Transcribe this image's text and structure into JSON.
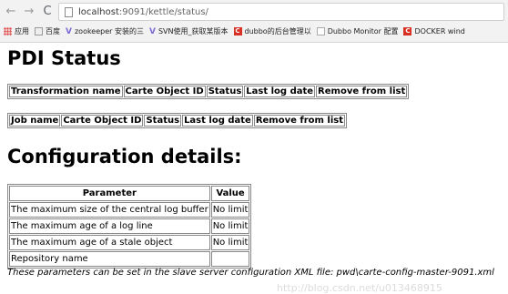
{
  "browser": {
    "back": "←",
    "forward": "→",
    "reload": "C",
    "url_host": "localhost",
    "url_rest": ":9091/kettle/status/",
    "bookmarks": [
      {
        "label": "应用",
        "icon": "apps-icon"
      },
      {
        "label": "百度",
        "icon": "folder-icon"
      },
      {
        "label": "zookeeper 安装的三",
        "icon": "v-icon"
      },
      {
        "label": "SVN使用_获取某版本",
        "icon": "v-icon"
      },
      {
        "label": "dubbo的后台管理以",
        "icon": "c-icon"
      },
      {
        "label": "Dubbo Monitor 配置",
        "icon": "page-icon"
      },
      {
        "label": "DOCKER wind",
        "icon": "c-icon"
      }
    ]
  },
  "page": {
    "title": "PDI Status",
    "transformations": {
      "headers": [
        "Transformation name",
        "Carte Object ID",
        "Status",
        "Last log date",
        "Remove from list"
      ]
    },
    "jobs": {
      "headers": [
        "Job name",
        "Carte Object ID",
        "Status",
        "Last log date",
        "Remove from list"
      ]
    },
    "config_title": "Configuration details:",
    "config": {
      "headers": [
        "Parameter",
        "Value"
      ],
      "rows": [
        {
          "param": "The maximum size of the central log buffer",
          "value": "No limit"
        },
        {
          "param": "The maximum age of a log line",
          "value": "No limit"
        },
        {
          "param": "The maximum age of a stale object",
          "value": "No limit"
        },
        {
          "param": "Repository name",
          "value": ""
        }
      ]
    },
    "note": "These parameters can be set in the slave server configuration XML file: pwd\\carte-config-master-9091.xml",
    "watermark": "http://blog.csdn.net/u013468915"
  }
}
